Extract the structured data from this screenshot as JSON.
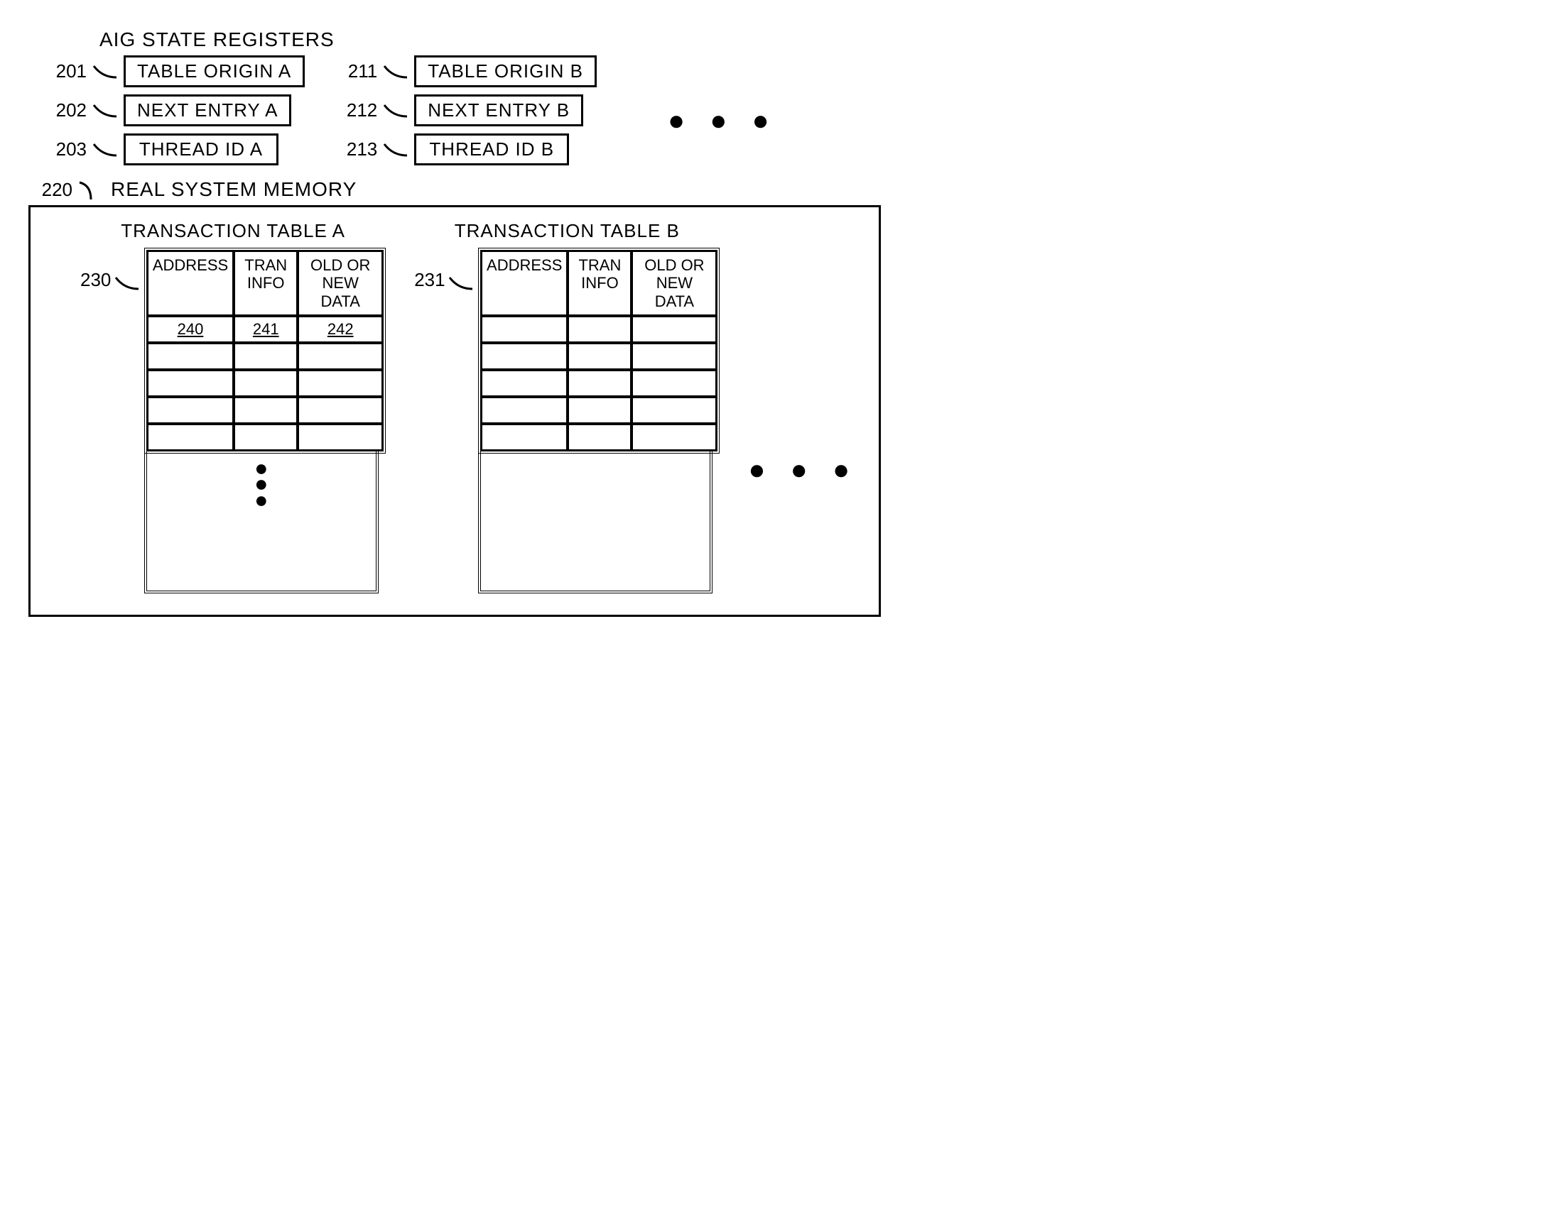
{
  "registers": {
    "title": "AIG STATE REGISTERS",
    "colA": {
      "items": [
        {
          "ref": "201",
          "label": "TABLE ORIGIN A"
        },
        {
          "ref": "202",
          "label": "NEXT ENTRY A"
        },
        {
          "ref": "203",
          "label": "THREAD ID A"
        }
      ]
    },
    "colB": {
      "items": [
        {
          "ref": "211",
          "label": "TABLE ORIGIN B"
        },
        {
          "ref": "212",
          "label": "NEXT ENTRY B"
        },
        {
          "ref": "213",
          "label": "THREAD ID B"
        }
      ]
    },
    "ellipsis": "● ● ●"
  },
  "memory": {
    "ref": "220",
    "title": "REAL SYSTEM MEMORY",
    "tableA": {
      "ref": "230",
      "title": "TRANSACTION TABLE A",
      "headers": {
        "addr": "ADDRESS",
        "tran": "TRAN INFO",
        "data": "OLD OR NEW DATA"
      },
      "refRow": {
        "addr": "240",
        "tran": "241",
        "data": "242"
      }
    },
    "tableB": {
      "ref": "231",
      "title": "TRANSACTION TABLE B",
      "headers": {
        "addr": "ADDRESS",
        "tran": "TRAN INFO",
        "data": "OLD OR NEW DATA"
      }
    },
    "ellipsis": "● ● ●"
  }
}
